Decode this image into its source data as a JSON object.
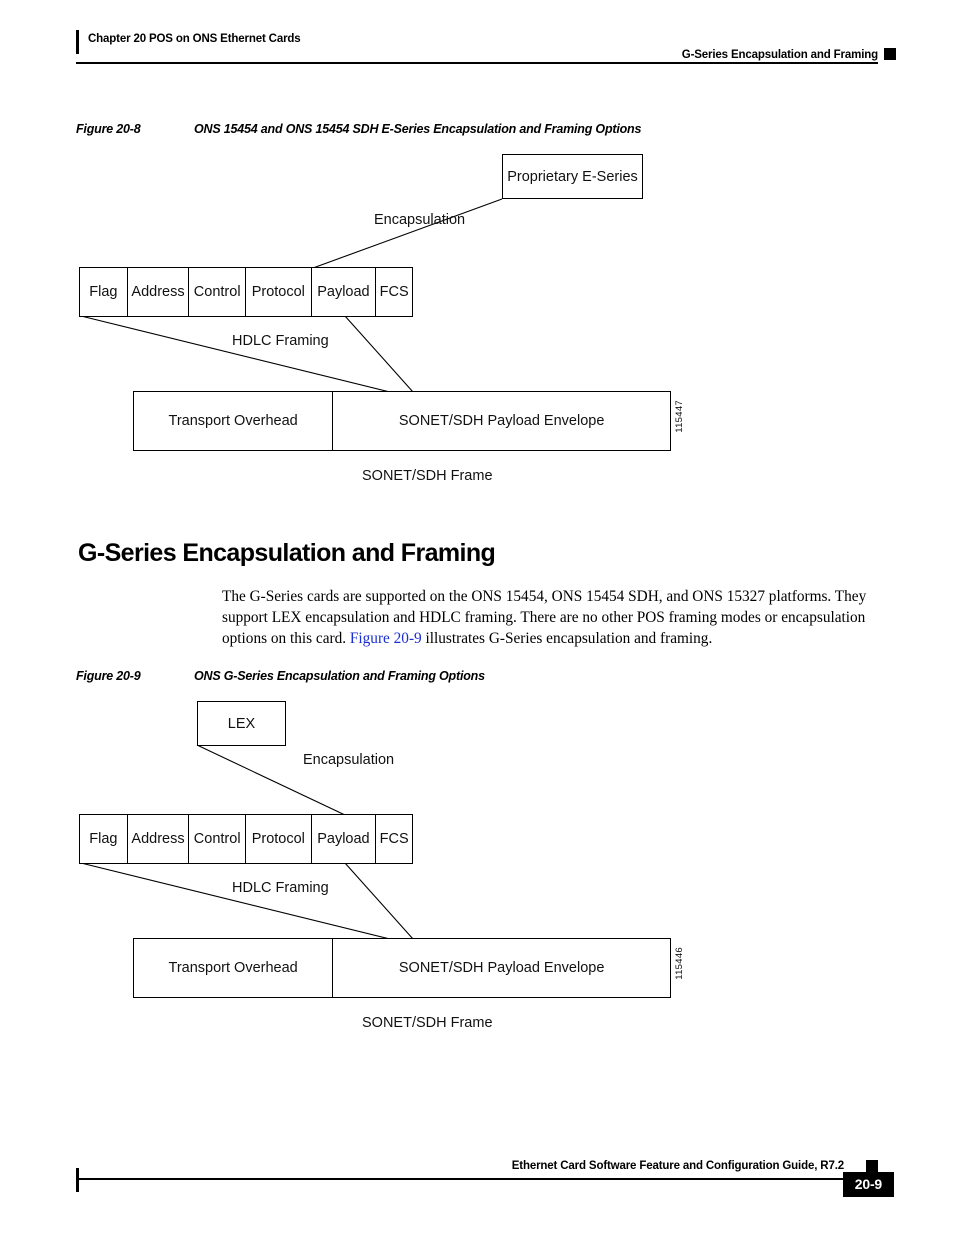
{
  "header": {
    "chapter": "Chapter 20      POS on ONS Ethernet Cards",
    "section": "G-Series Encapsulation and Framing"
  },
  "figure1": {
    "caption_number": "Figure 20-8",
    "caption_title": "ONS 15454 and ONS 15454 SDH E-Series Encapsulation and Framing Options",
    "encapsulation_box": "Proprietary E-Series",
    "encapsulation_label": "Encapsulation",
    "framing_label": "HDLC Framing",
    "hdlc_cells": [
      "Flag",
      "Address",
      "Control",
      "Protocol",
      "Payload",
      "FCS"
    ],
    "sonet_cells": [
      "Transport Overhead",
      "SONET/SDH Payload Envelope"
    ],
    "frame_label": "SONET/SDH Frame",
    "figure_id": "115447"
  },
  "section": {
    "heading": "G-Series Encapsulation and Framing",
    "paragraph_part1": "The G-Series cards are supported on the ONS 15454, ONS 15454 SDH, and ONS 15327 platforms. They support LEX encapsulation and HDLC framing. There are no other POS framing modes or encapsulation options on this card. ",
    "paragraph_link": "Figure 20-9",
    "paragraph_part2": " illustrates G-Series encapsulation and framing."
  },
  "figure2": {
    "caption_number": "Figure 20-9",
    "caption_title": "ONS G-Series Encapsulation and Framing Options",
    "encapsulation_box": "LEX",
    "encapsulation_label": "Encapsulation",
    "framing_label": "HDLC Framing",
    "hdlc_cells": [
      "Flag",
      "Address",
      "Control",
      "Protocol",
      "Payload",
      "FCS"
    ],
    "sonet_cells": [
      "Transport Overhead",
      "SONET/SDH Payload Envelope"
    ],
    "frame_label": "SONET/SDH Frame",
    "figure_id": "115446"
  },
  "footer": {
    "guide_title": "Ethernet Card Software Feature and Configuration Guide, R7.2",
    "page_number": "20-9"
  }
}
